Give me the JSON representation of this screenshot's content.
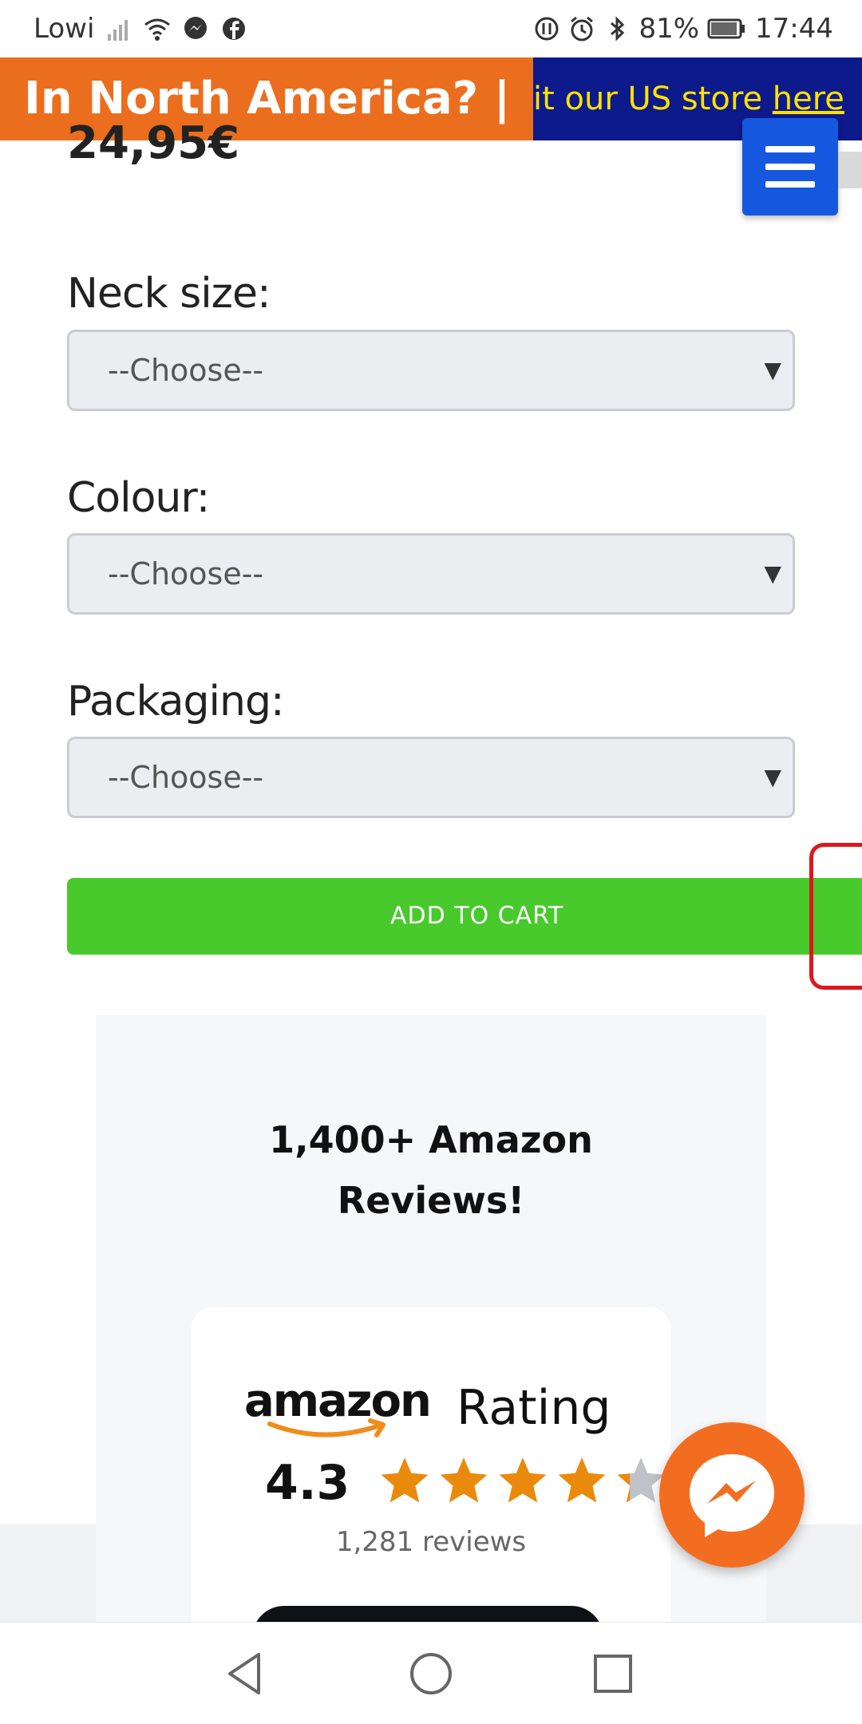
{
  "status_bar": {
    "carrier": "Lowi",
    "battery": "81%",
    "time": "17:44",
    "icons": [
      "signal-icon",
      "wifi-icon",
      "messenger-notification-icon",
      "facebook-notification-icon",
      "data-saver-icon",
      "alarm-icon",
      "bluetooth-icon",
      "battery-icon"
    ]
  },
  "promo_banner": {
    "orange_text": "In North America? |",
    "blue_text_prefix": "it our US store ",
    "link_text": "here",
    "colors": {
      "orange": "#eb6e1e",
      "navy": "#0c1a8c",
      "yellow": "#ffe100"
    }
  },
  "product": {
    "price_partial": "24,95€"
  },
  "header": {
    "menu_icon": "hamburger-menu-icon"
  },
  "options": [
    {
      "label": "Neck size:",
      "value": "--Choose--"
    },
    {
      "label": "Colour:",
      "value": "--Choose--"
    },
    {
      "label": "Packaging:",
      "value": "--Choose--"
    }
  ],
  "cart": {
    "add_label": "ADD TO CART",
    "color": "#48c92c"
  },
  "reviews": {
    "title_line1": "1,400+ Amazon",
    "title_line2": "Reviews!",
    "brand": "amazon",
    "rating_label": "Rating",
    "rating_value": "4.3",
    "stars": 4.3,
    "count_text": "1,281 reviews"
  },
  "chat": {
    "icon": "messenger-icon",
    "color": "#f36d21"
  },
  "nav": {
    "icons": [
      "back-icon",
      "home-icon",
      "recents-icon"
    ]
  }
}
